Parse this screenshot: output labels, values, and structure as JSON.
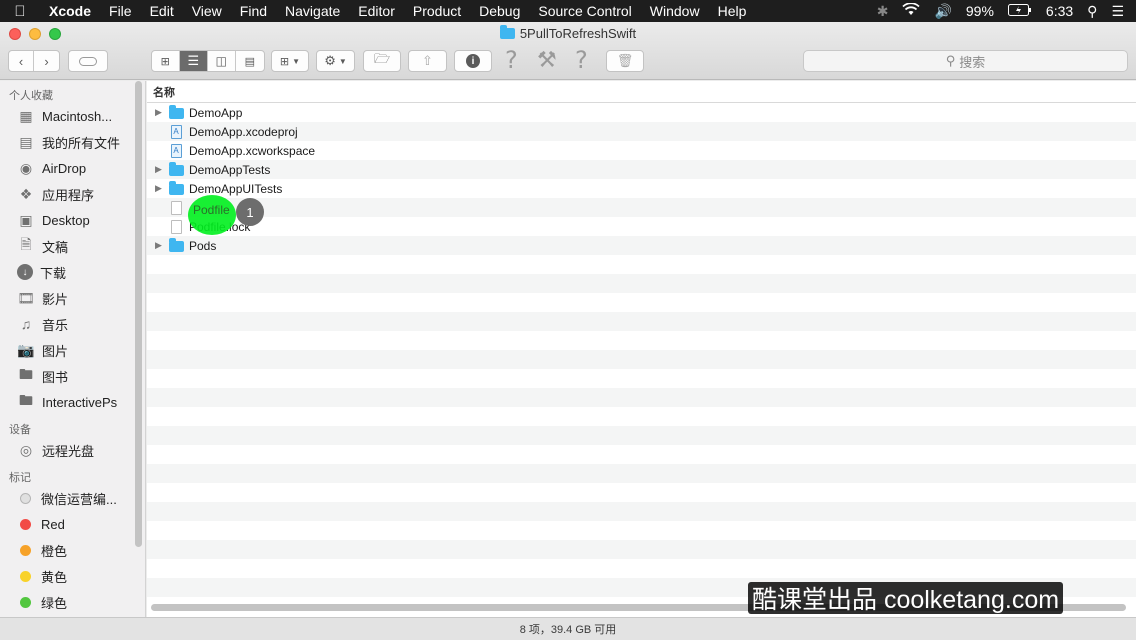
{
  "menubar": {
    "items": [
      "Xcode",
      "File",
      "Edit",
      "View",
      "Find",
      "Navigate",
      "Editor",
      "Product",
      "Debug",
      "Source Control",
      "Window",
      "Help"
    ],
    "battery": "99%",
    "time": "6:33"
  },
  "window": {
    "title": "5PullToRefreshSwift"
  },
  "search": {
    "placeholder": "搜索"
  },
  "sidebar": {
    "favorites_label": "个人收藏",
    "favorites": [
      {
        "label": "Macintosh...",
        "icon": "disk-icon"
      },
      {
        "label": "我的所有文件",
        "icon": "all-files-icon"
      },
      {
        "label": "AirDrop",
        "icon": "airdrop-icon"
      },
      {
        "label": "应用程序",
        "icon": "applications-icon"
      },
      {
        "label": "Desktop",
        "icon": "desktop-icon"
      },
      {
        "label": "文稿",
        "icon": "documents-icon"
      },
      {
        "label": "下载",
        "icon": "downloads-icon"
      },
      {
        "label": "影片",
        "icon": "movies-icon"
      },
      {
        "label": "音乐",
        "icon": "music-icon"
      },
      {
        "label": "图片",
        "icon": "pictures-icon"
      },
      {
        "label": "图书",
        "icon": "folder-icon"
      },
      {
        "label": "InteractivePs",
        "icon": "folder-icon"
      }
    ],
    "devices_label": "设备",
    "devices": [
      {
        "label": "远程光盘",
        "icon": "remote-disc-icon"
      }
    ],
    "tags_label": "标记",
    "tags": [
      {
        "label": "微信运营编...",
        "color": "#e0e0e0"
      },
      {
        "label": "Red",
        "color": "#f24b46"
      },
      {
        "label": "橙色",
        "color": "#f6a229"
      },
      {
        "label": "黄色",
        "color": "#f8d22a"
      },
      {
        "label": "绿色",
        "color": "#52c63f"
      }
    ]
  },
  "list": {
    "column_header": "名称",
    "rows": [
      {
        "name": "DemoApp",
        "type": "folder",
        "expandable": true
      },
      {
        "name": "DemoApp.xcodeproj",
        "type": "xcode",
        "expandable": false
      },
      {
        "name": "DemoApp.xcworkspace",
        "type": "xcode",
        "expandable": false
      },
      {
        "name": "DemoAppTests",
        "type": "folder",
        "expandable": true
      },
      {
        "name": "DemoAppUITests",
        "type": "folder",
        "expandable": true
      },
      {
        "name": "",
        "type": "file",
        "expandable": false
      },
      {
        "name": "Podfile.lock",
        "type": "file",
        "expandable": false
      },
      {
        "name": "Pods",
        "type": "folder",
        "expandable": true
      }
    ],
    "highlighted_file": "Podfile",
    "step_number": "1"
  },
  "statusbar": {
    "text": "8 项，39.4 GB 可用"
  },
  "watermark": {
    "text": "酷课堂出品 coolketang.com"
  }
}
